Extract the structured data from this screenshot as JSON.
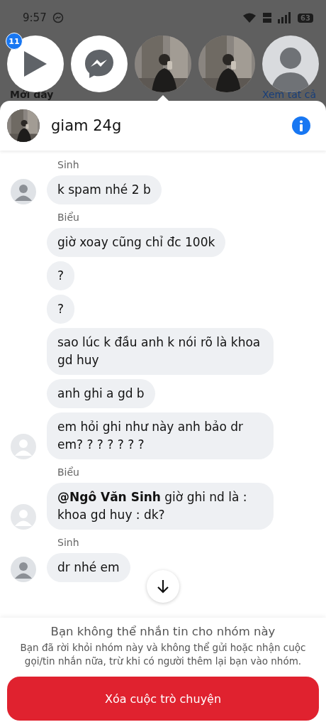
{
  "status_bar": {
    "time": "9:57",
    "battery": "63"
  },
  "background": {
    "section_title": "Mới đây",
    "see_all": "Xem tất cả"
  },
  "stories": [
    {
      "kind": "play",
      "badge": "11"
    },
    {
      "kind": "messenger"
    },
    {
      "kind": "picture"
    },
    {
      "kind": "picture"
    },
    {
      "kind": "person"
    }
  ],
  "chat": {
    "title": "giam 24g"
  },
  "groups": [
    {
      "sender": "Sinh",
      "avatar": {
        "kind": "filled"
      },
      "messages": [
        "k spam nhé 2 b"
      ]
    },
    {
      "sender": "Biểu",
      "avatar": {
        "kind": "outline"
      },
      "messages": [
        "giờ xoay cũng chỉ đc 100k",
        "?",
        "?",
        "sao lúc k đầu anh k nói rõ  là khoa gd huy",
        "anh ghi a gd b",
        "em hỏi ghi như này anh bảo dr em? ? ? ? ? ? ?"
      ]
    },
    {
      "sender": "Biểu",
      "avatar": {
        "kind": "outline"
      },
      "messages": [
        "**@Ngô Văn Sinh** giờ ghi nd là : khoa gd huy : dk?"
      ]
    },
    {
      "sender": "Sinh",
      "avatar": {
        "kind": "filled"
      },
      "messages": [
        "dr nhé em"
      ]
    }
  ],
  "notice": {
    "title": "Bạn không thể nhắn tin cho nhóm này",
    "body": "Bạn đã rời khỏi nhóm này và không thể gửi hoặc nhận cuộc gọi/tin nhắn nữa,  trừ khi có người thêm lại bạn vào nhóm.",
    "button": "Xóa cuộc trò chuyện"
  }
}
